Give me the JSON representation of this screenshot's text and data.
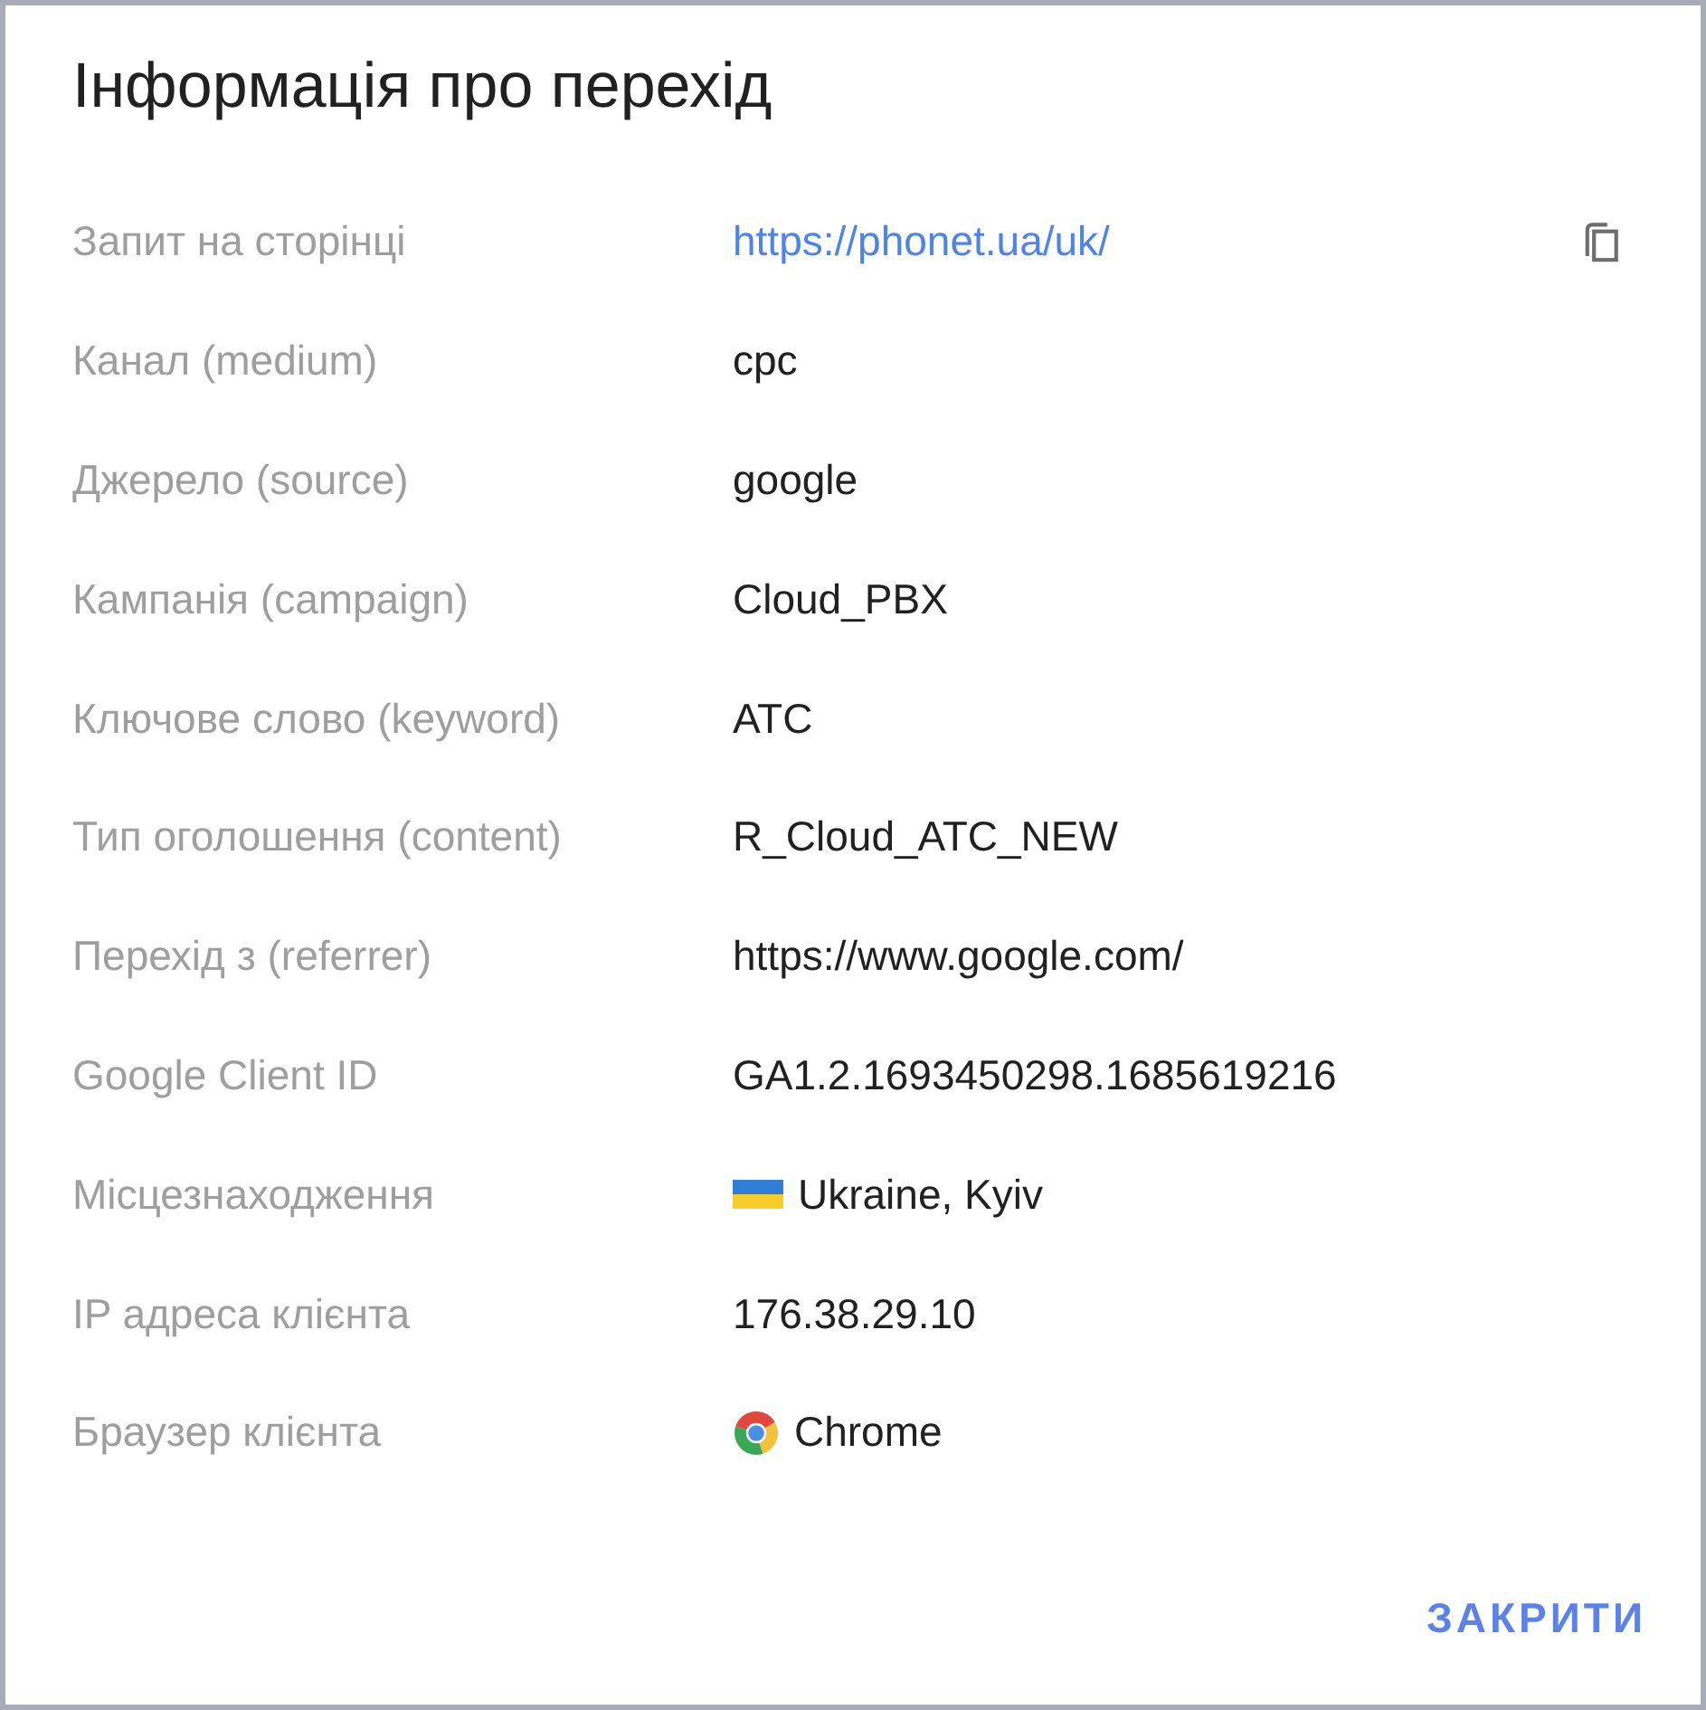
{
  "dialog": {
    "title": "Інформація про перехід"
  },
  "rows": [
    {
      "kind": "link",
      "label": "Запит на сторінці",
      "value": "https://phonet.ua/uk/"
    },
    {
      "kind": "text",
      "label": "Канал (medium)",
      "value": "cpc"
    },
    {
      "kind": "text",
      "label": "Джерело (source)",
      "value": "google"
    },
    {
      "kind": "text",
      "label": "Кампанія (campaign)",
      "value": "Cloud_PBX"
    },
    {
      "kind": "text",
      "label": "Ключове слово (keyword)",
      "value": "АТС"
    },
    {
      "kind": "text",
      "label": "Тип оголошення (content)",
      "value": "R_Cloud_АТС_NEW"
    },
    {
      "kind": "text",
      "label": "Перехід з (referrer)",
      "value": "https://www.google.com/"
    },
    {
      "kind": "text",
      "label": "Google Client ID",
      "value": "GA1.2.1693450298.1685619216"
    },
    {
      "kind": "flag",
      "label": "Місцезнаходження",
      "value": "Ukraine, Kyiv"
    },
    {
      "kind": "text",
      "label": "IP адреса клієнта",
      "value": "176.38.29.10"
    },
    {
      "kind": "browser",
      "label": "Браузер клієнта",
      "value": "Chrome"
    }
  ],
  "buttons": [
    {
      "label": "ЗАКРИТИ"
    }
  ]
}
